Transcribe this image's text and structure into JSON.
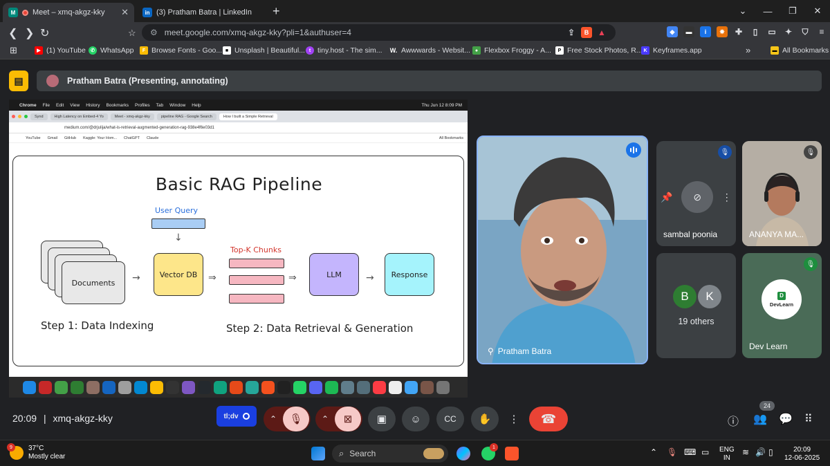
{
  "browser": {
    "tabs": [
      {
        "label": "Meet – xmq-akgz-kky",
        "active": true
      },
      {
        "label": "(3) Pratham Batra | LinkedIn",
        "active": false
      }
    ],
    "url": "meet.google.com/xmq-akgz-kky?pli=1&authuser=4",
    "bookmarks": [
      "(1) YouTube",
      "WhatsApp",
      "Browse Fonts - Goo...",
      "Unsplash | Beautiful...",
      "tiny.host - The sim...",
      "Awwwards - Websit...",
      "Flexbox Froggy - A...",
      "Free Stock Photos, R...",
      "Keyframes.app"
    ],
    "all_bookmarks": "All Bookmarks",
    "more": "»"
  },
  "meet": {
    "presenter_banner": "Pratham Batra (Presenting, annotating)",
    "meeting_time": "20:09",
    "meeting_code": "xmq-akgz-kky",
    "separator": "|",
    "annotate_label": "tl;dv",
    "people_count": "24",
    "participants": {
      "main": "Pratham Batra",
      "tile1": "sambal poonia",
      "tile2": "ANANYA MA...",
      "others_count": "19 others",
      "others_avatars": [
        "B",
        "K"
      ],
      "tile4": "Dev Learn",
      "devlearn_logo": "DevLearn",
      "devlearn_letter": "D"
    }
  },
  "shared_screen": {
    "mac_menu": [
      "Chrome",
      "File",
      "Edit",
      "View",
      "History",
      "Bookmarks",
      "Profiles",
      "Tab",
      "Window",
      "Help"
    ],
    "mac_clock": "Thu Jun 12  8:09 PM",
    "inner_tabs": [
      "Synd",
      "High Latency on Embed-4 Yo",
      "Meet - xmq-akgz-kky",
      "pipeline RAG - Google Search",
      "How I built a Simple Retrieval"
    ],
    "inner_url": "medium.com/@drjulija/what-is-retrieval-augmented-generation-rag-938e4f6e03d1",
    "inner_bookmarks": [
      "YouTube",
      "Gmail",
      "GitHub",
      "Kaggle: Your Hom...",
      "ChatGPT",
      "Claude"
    ],
    "inner_all_bookmarks": "All Bookmarks",
    "diagram": {
      "title": "Basic RAG Pipeline",
      "user_query": "User Query",
      "documents": "Documents",
      "vector_db": "Vector DB",
      "topk": "Top-K Chunks",
      "llm": "LLM",
      "response": "Response",
      "step1": "Step 1: Data Indexing",
      "step2": "Step 2: Data Retrieval & Generation"
    }
  },
  "taskbar": {
    "weather_temp": "37°C",
    "weather_desc": "Mostly clear",
    "weather_badge": "9",
    "search": "Search",
    "whatsapp_badge": "1",
    "lang": "ENG",
    "region": "IN",
    "time": "20:09",
    "date": "12-06-2025"
  },
  "colors": {
    "meet_bg": "#202124",
    "accent_blue": "#8ab4f8",
    "end_call_red": "#ea4335",
    "muted_pink": "#f6c9c7",
    "presenting_yellow": "#fbbc04"
  }
}
